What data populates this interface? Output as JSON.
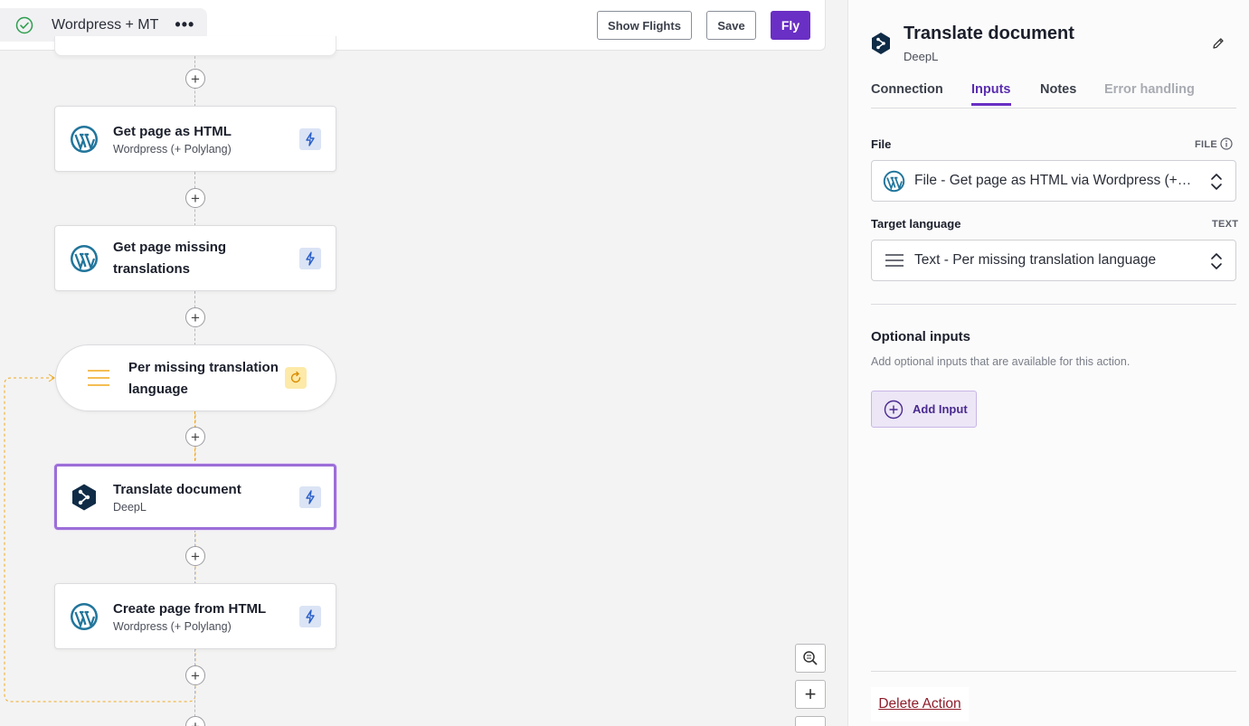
{
  "topbar": {
    "flow_name": "Wordpress + MT",
    "more_label": "•••",
    "show_flights_label": "Show Flights",
    "save_label": "Save",
    "fly_label": "Fly"
  },
  "canvas": {
    "plus_label": "+",
    "nodes": [
      {
        "title": "Get page as HTML",
        "subtitle": "Wordpress (+ Polylang)",
        "icon": "wordpress-icon"
      },
      {
        "title": "Get page missing translations",
        "subtitle": "",
        "icon": "wordpress-icon"
      },
      {
        "title": "Per missing translation language",
        "icon": "list-lines-icon",
        "type": "loop"
      },
      {
        "title": "Translate document",
        "subtitle": "DeepL",
        "icon": "deepl-icon",
        "selected": true
      },
      {
        "title": "Create page from HTML",
        "subtitle": "Wordpress (+ Polylang)",
        "icon": "wordpress-icon"
      }
    ],
    "zoom": {
      "plus_label": "+"
    }
  },
  "panel": {
    "title": "Translate document",
    "subtitle": "DeepL",
    "tabs": [
      {
        "label": "Connection",
        "state": "normal"
      },
      {
        "label": "Inputs",
        "state": "active"
      },
      {
        "label": "Notes",
        "state": "normal"
      },
      {
        "label": "Error handling",
        "state": "disabled"
      }
    ],
    "fields": [
      {
        "label": "File",
        "type": "FILE",
        "value": "File - Get page as HTML via Wordpress (+ Polylang)",
        "icon": "wordpress-icon"
      },
      {
        "label": "Target language",
        "type": "TEXT",
        "value": "Text - Per missing translation language",
        "icon": "list-lines-icon"
      }
    ],
    "optional": {
      "title": "Optional inputs",
      "description": "Add optional inputs that are available for this action.",
      "add_label": "Add Input"
    },
    "delete_label": "Delete Action"
  },
  "colors": {
    "accent": "#6a2fc4",
    "loop": "#f0a81c",
    "bolt_bg": "#dbe4f5",
    "danger": "#8e1d2c"
  }
}
